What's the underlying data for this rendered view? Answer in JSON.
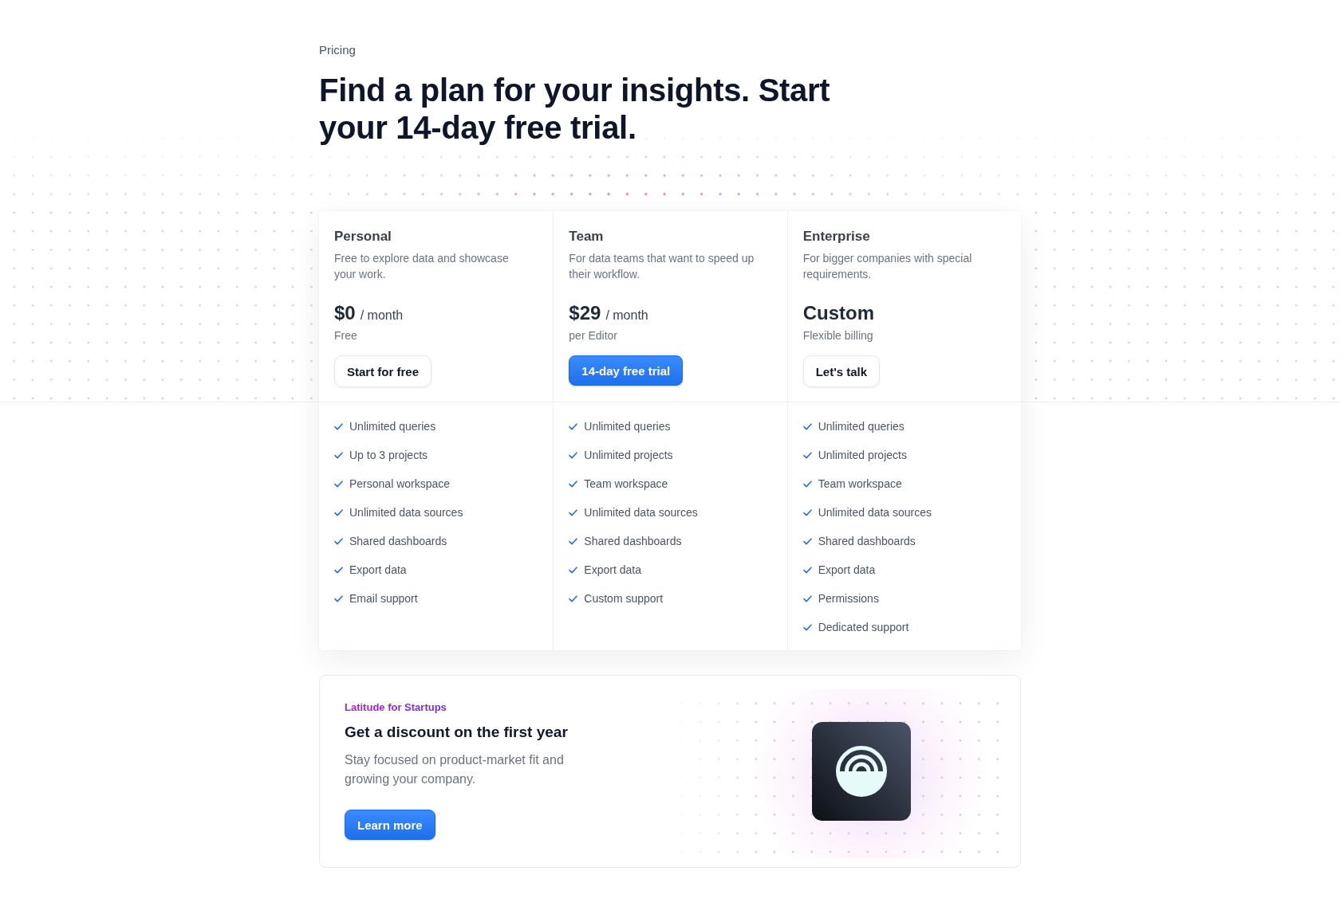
{
  "eyebrow": "Pricing",
  "heading": "Find a plan for your insights. Start your 14-day free trial.",
  "plans": [
    {
      "name": "Personal",
      "description": "Free to explore data and showcase your work.",
      "price": "$0",
      "period": "/ month",
      "billing": "Free",
      "button": {
        "label": "Start for free",
        "kind": "secondary"
      },
      "features": [
        "Unlimited queries",
        "Up to 3 projects",
        "Personal workspace",
        "Unlimited data sources",
        "Shared dashboards",
        "Export data",
        "Email support"
      ]
    },
    {
      "name": "Team",
      "description": "For data teams that want to speed up their workflow.",
      "price": "$29",
      "period": "/ month",
      "billing": "per Editor",
      "button": {
        "label": "14-day free trial",
        "kind": "primary"
      },
      "features": [
        "Unlimited queries",
        "Unlimited projects",
        "Team workspace",
        "Unlimited data sources",
        "Shared dashboards",
        "Export data",
        "Custom support"
      ]
    },
    {
      "name": "Enterprise",
      "description": "For bigger companies with special requirements.",
      "price": "Custom",
      "billing": "Flexible billing",
      "button": {
        "label": "Let's talk",
        "kind": "secondary"
      },
      "features": [
        "Unlimited queries",
        "Unlimited projects",
        "Team workspace",
        "Unlimited data sources",
        "Shared dashboards",
        "Export data",
        "Permissions",
        "Dedicated support"
      ]
    }
  ],
  "startups": {
    "eyebrow": "Latitude for Startups",
    "title": "Get a discount on the first year",
    "description": "Stay focused on product-market fit and growing your company.",
    "button": {
      "label": "Learn more",
      "kind": "primary"
    }
  }
}
